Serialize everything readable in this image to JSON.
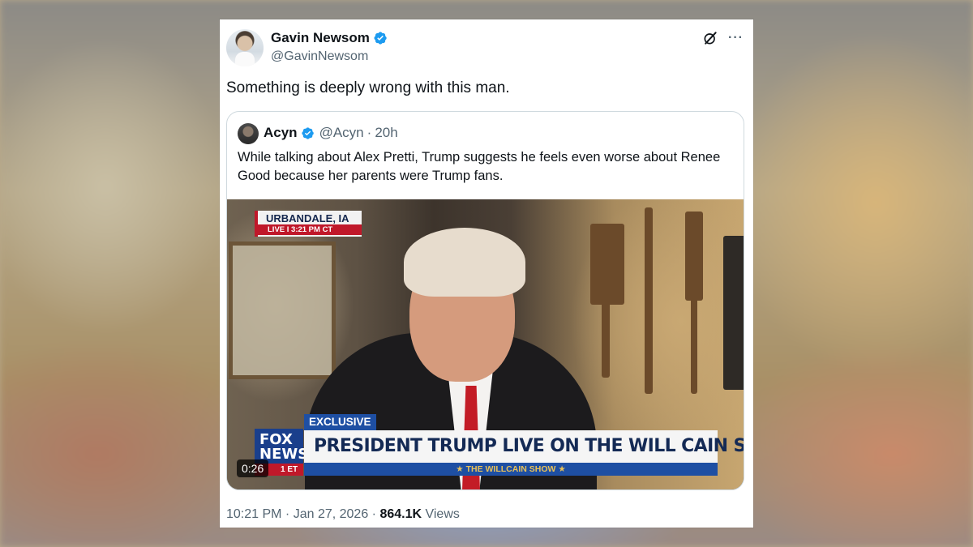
{
  "post": {
    "author": {
      "display_name": "Gavin Newsom",
      "handle": "@GavinNewsom",
      "verified_icon": "verified-badge-icon"
    },
    "top_icons": [
      "grok-icon",
      "more-options-icon"
    ],
    "more_label": "···",
    "text": "Something is deeply wrong with this man.",
    "timestamp": "10:21 PM · Jan 27, 2026 · ",
    "views_count": "864.1K",
    "views_label": " Views"
  },
  "quote": {
    "author": {
      "display_name": "Acyn",
      "handle": "@Acyn",
      "separator": "·",
      "time_ago": "20h"
    },
    "text": "While talking about Alex Pretti, Trump suggests he feels even worse about Renee Good because her parents were Trump fans.",
    "video": {
      "duration": "0:26",
      "location_bug": "URBANDALE, IA",
      "live_bug": "LIVE  I  3:21 PM CT",
      "exclusive_tag": "EXCLUSIVE",
      "headline": "PRESIDENT TRUMP LIVE ON THE WILL CAIN SHOW",
      "show_bar": "★ THE WILLCAIN SHOW ★",
      "network_logo": "FOX NEWS",
      "logo_et": "1 ET"
    }
  },
  "colors": {
    "verified_blue": "#1d9bf0",
    "text_primary": "#0f1419",
    "text_secondary": "#536471",
    "border": "#cfd9de"
  }
}
